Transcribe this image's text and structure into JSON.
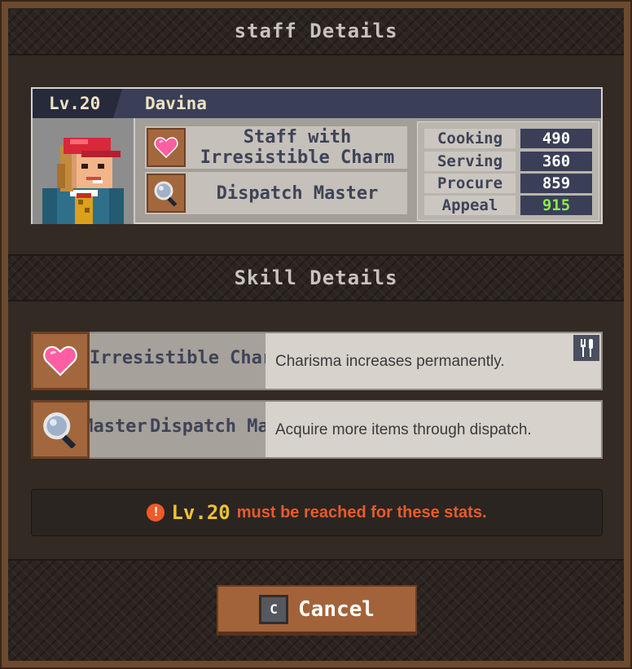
{
  "dialog": {
    "title": "staff Details",
    "section_title": "Skill Details"
  },
  "staff": {
    "level": "Lv.20",
    "name": "Davina",
    "traits": [
      {
        "label": "Staff with Irresistible Charm",
        "icon": "heart-icon"
      },
      {
        "label": "Dispatch Master",
        "icon": "magnifier-icon"
      }
    ],
    "stats": [
      {
        "label": "Cooking",
        "value": "490",
        "color": "#ffffff"
      },
      {
        "label": "Serving",
        "value": "360",
        "color": "#ffffff"
      },
      {
        "label": "Procure",
        "value": "859",
        "color": "#ffffff"
      },
      {
        "label": "Appeal",
        "value": "915",
        "color": "#8bea4e"
      }
    ]
  },
  "skills": [
    {
      "name": "Irresistible Charm",
      "description": "Charisma increases permanently.",
      "icon": "heart-icon",
      "tag_icon": "cutlery-icon"
    },
    {
      "name": "Dispatch Master",
      "description": "Acquire more items through dispatch.",
      "icon": "magnifier-icon"
    }
  ],
  "warning": {
    "level": "Lv.20",
    "message": "must be reached for these stats."
  },
  "buttons": {
    "cancel_key": "C",
    "cancel_label": "Cancel"
  }
}
